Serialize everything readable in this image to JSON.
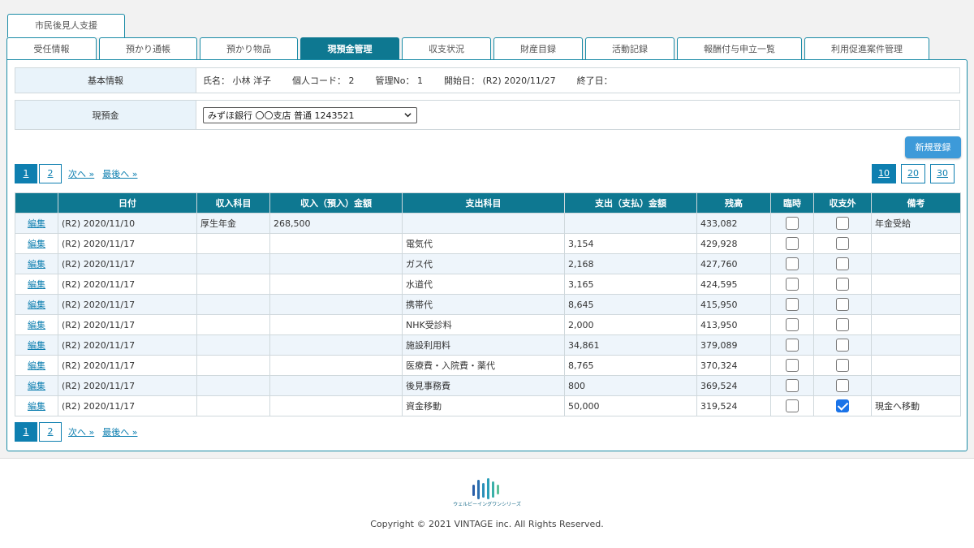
{
  "app_tab": "市民後見人支援",
  "tabs": [
    {
      "label": "受任情報"
    },
    {
      "label": "預かり通帳"
    },
    {
      "label": "預かり物品"
    },
    {
      "label": "現預金管理"
    },
    {
      "label": "収支状況"
    },
    {
      "label": "財産目録"
    },
    {
      "label": "活動記録"
    },
    {
      "label": "報酬付与申立一覧"
    },
    {
      "label": "利用促進案件管理"
    }
  ],
  "active_tab": "現預金管理",
  "basic_info": {
    "label": "基本情報",
    "name": "氏名： 小林 洋子",
    "personal_code": "個人コード： 2",
    "management_no": "管理No： 1",
    "start_date": "開始日： (R2) 2020/11/27",
    "end_date": "終了日："
  },
  "cash": {
    "label": "現預金",
    "selected_account": "みずほ銀行 〇〇支店 普通 1243521"
  },
  "new_button": "新規登録",
  "pager": {
    "pages": [
      "1",
      "2"
    ],
    "current_page": "1",
    "next": "次へ »",
    "last": "最後へ »"
  },
  "page_size": {
    "options": [
      "10",
      "20",
      "30"
    ],
    "selected": "10"
  },
  "table": {
    "headers": [
      "",
      "日付",
      "収入科目",
      "収入（預入）金額",
      "支出科目",
      "支出（支払）金額",
      "残高",
      "臨時",
      "収支外",
      "備考"
    ],
    "edit_label": "編集",
    "rows": [
      {
        "date": "(R2) 2020/11/10",
        "income_item": "厚生年金",
        "income_amount": "268,500",
        "expense_item": "",
        "expense_amount": "",
        "balance": "433,082",
        "temporary": false,
        "off_balance": false,
        "note": "年金受給"
      },
      {
        "date": "(R2) 2020/11/17",
        "income_item": "",
        "income_amount": "",
        "expense_item": "電気代",
        "expense_amount": "3,154",
        "balance": "429,928",
        "temporary": false,
        "off_balance": false,
        "note": ""
      },
      {
        "date": "(R2) 2020/11/17",
        "income_item": "",
        "income_amount": "",
        "expense_item": "ガス代",
        "expense_amount": "2,168",
        "balance": "427,760",
        "temporary": false,
        "off_balance": false,
        "note": ""
      },
      {
        "date": "(R2) 2020/11/17",
        "income_item": "",
        "income_amount": "",
        "expense_item": "水道代",
        "expense_amount": "3,165",
        "balance": "424,595",
        "temporary": false,
        "off_balance": false,
        "note": ""
      },
      {
        "date": "(R2) 2020/11/17",
        "income_item": "",
        "income_amount": "",
        "expense_item": "携帯代",
        "expense_amount": "8,645",
        "balance": "415,950",
        "temporary": false,
        "off_balance": false,
        "note": ""
      },
      {
        "date": "(R2) 2020/11/17",
        "income_item": "",
        "income_amount": "",
        "expense_item": "NHK受診料",
        "expense_amount": "2,000",
        "balance": "413,950",
        "temporary": false,
        "off_balance": false,
        "note": ""
      },
      {
        "date": "(R2) 2020/11/17",
        "income_item": "",
        "income_amount": "",
        "expense_item": "施設利用料",
        "expense_amount": "34,861",
        "balance": "379,089",
        "temporary": false,
        "off_balance": false,
        "note": ""
      },
      {
        "date": "(R2) 2020/11/17",
        "income_item": "",
        "income_amount": "",
        "expense_item": "医療費・入院費・薬代",
        "expense_amount": "8,765",
        "balance": "370,324",
        "temporary": false,
        "off_balance": false,
        "note": ""
      },
      {
        "date": "(R2) 2020/11/17",
        "income_item": "",
        "income_amount": "",
        "expense_item": "後見事務費",
        "expense_amount": "800",
        "balance": "369,524",
        "temporary": false,
        "off_balance": false,
        "note": ""
      },
      {
        "date": "(R2) 2020/11/17",
        "income_item": "",
        "income_amount": "",
        "expense_item": "資金移動",
        "expense_amount": "50,000",
        "balance": "319,524",
        "temporary": false,
        "off_balance": true,
        "note": "現金へ移動"
      }
    ]
  },
  "footer": {
    "logo_text": "ウェルビーイングワンシリーズ",
    "copyright": "Copyright © 2021 VINTAGE inc. All Rights Reserved."
  },
  "colors": {
    "accent": "#0e7891",
    "link": "#0e7fb0",
    "button": "#3d9ad9",
    "row_alt": "#eef5fb",
    "label_bg": "#e9f3fa"
  }
}
